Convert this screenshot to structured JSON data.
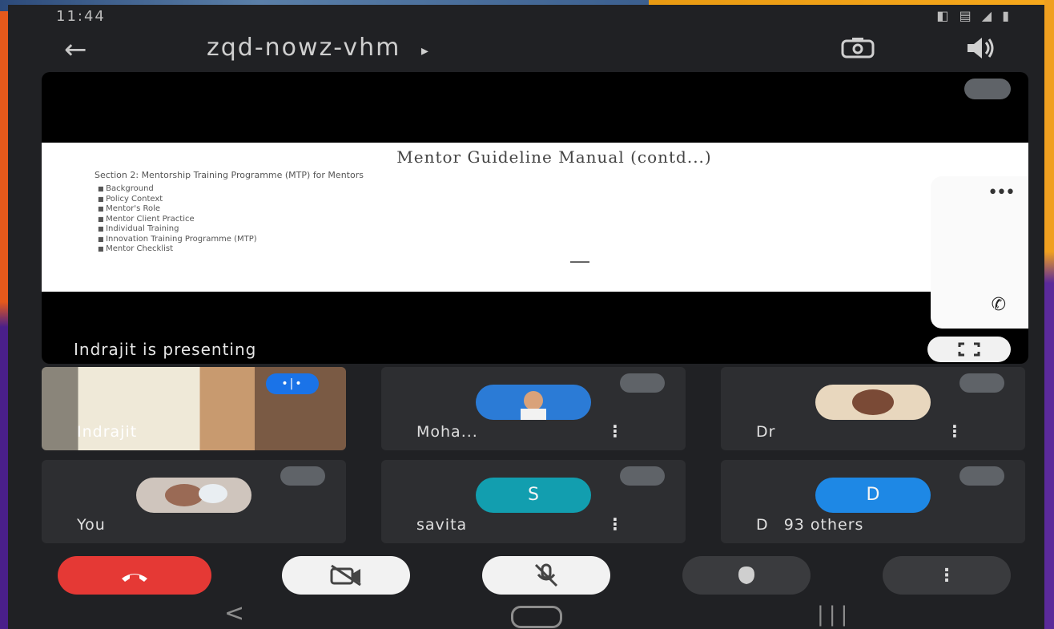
{
  "statusbar": {
    "time": "11:44",
    "icons": "◧ ▤ ◢ ▮"
  },
  "meeting": {
    "code": "zqd-nowz-vhm",
    "code_arrow": "▸"
  },
  "slide": {
    "title": "Mentor Guideline Manual (contd...)",
    "subtitle": "Section 2: Mentorship Training Programme (MTP) for Mentors",
    "items": [
      "Background",
      "Policy Context",
      "Mentor's Role",
      "Mentor Client Practice",
      "Individual Training",
      "Innovation Training Programme (MTP)",
      "Mentor Checklist"
    ]
  },
  "stage": {
    "presenting_text": "Indrajit is presenting"
  },
  "participants": [
    {
      "name": "Indrajit",
      "speaking": "•|•"
    },
    {
      "name": "Moha...",
      "more": "⋮"
    },
    {
      "name": "Dr",
      "more": "⋮"
    },
    {
      "name": "You"
    },
    {
      "name": "savita",
      "letter": "S",
      "more": "⋮"
    },
    {
      "name": "D",
      "letter": "D",
      "others": "93 others"
    }
  ],
  "colors": {
    "end_call": "#e53935",
    "tile_bg": "#2d2e31",
    "savita_avatar": "#129eaf",
    "d_avatar": "#1e88e5",
    "speaking_badge": "#1a73e8"
  },
  "controls": {
    "more": "⋮"
  },
  "navbar": {
    "back": "<",
    "recent": "|||"
  }
}
